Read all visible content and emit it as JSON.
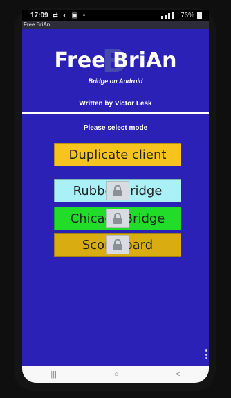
{
  "status_bar": {
    "time": "17:09",
    "left_icons": "⇄ ◐ ▣ •",
    "battery": "76%"
  },
  "window_title": "Free BriAn",
  "header": {
    "logo_mark": "B",
    "title": "Free BriAn",
    "subtitle": "Bridge on Android",
    "author": "Written by Victor Lesk"
  },
  "prompt": "Please select mode",
  "modes": [
    {
      "label": "Duplicate client",
      "locked": false,
      "color": "#f6c31f"
    },
    {
      "label": "Rubber Bridge",
      "locked": true,
      "color": "#a9f1f6"
    },
    {
      "label": "Chicago Bridge",
      "locked": true,
      "color": "#22dc2a"
    },
    {
      "label": "Scoreboard",
      "locked": true,
      "color": "#d9ad12"
    }
  ],
  "nav": {
    "recents": "|||",
    "home": "○",
    "back": "<"
  },
  "colors": {
    "background": "#2b21b7",
    "divider": "#ffffff"
  }
}
